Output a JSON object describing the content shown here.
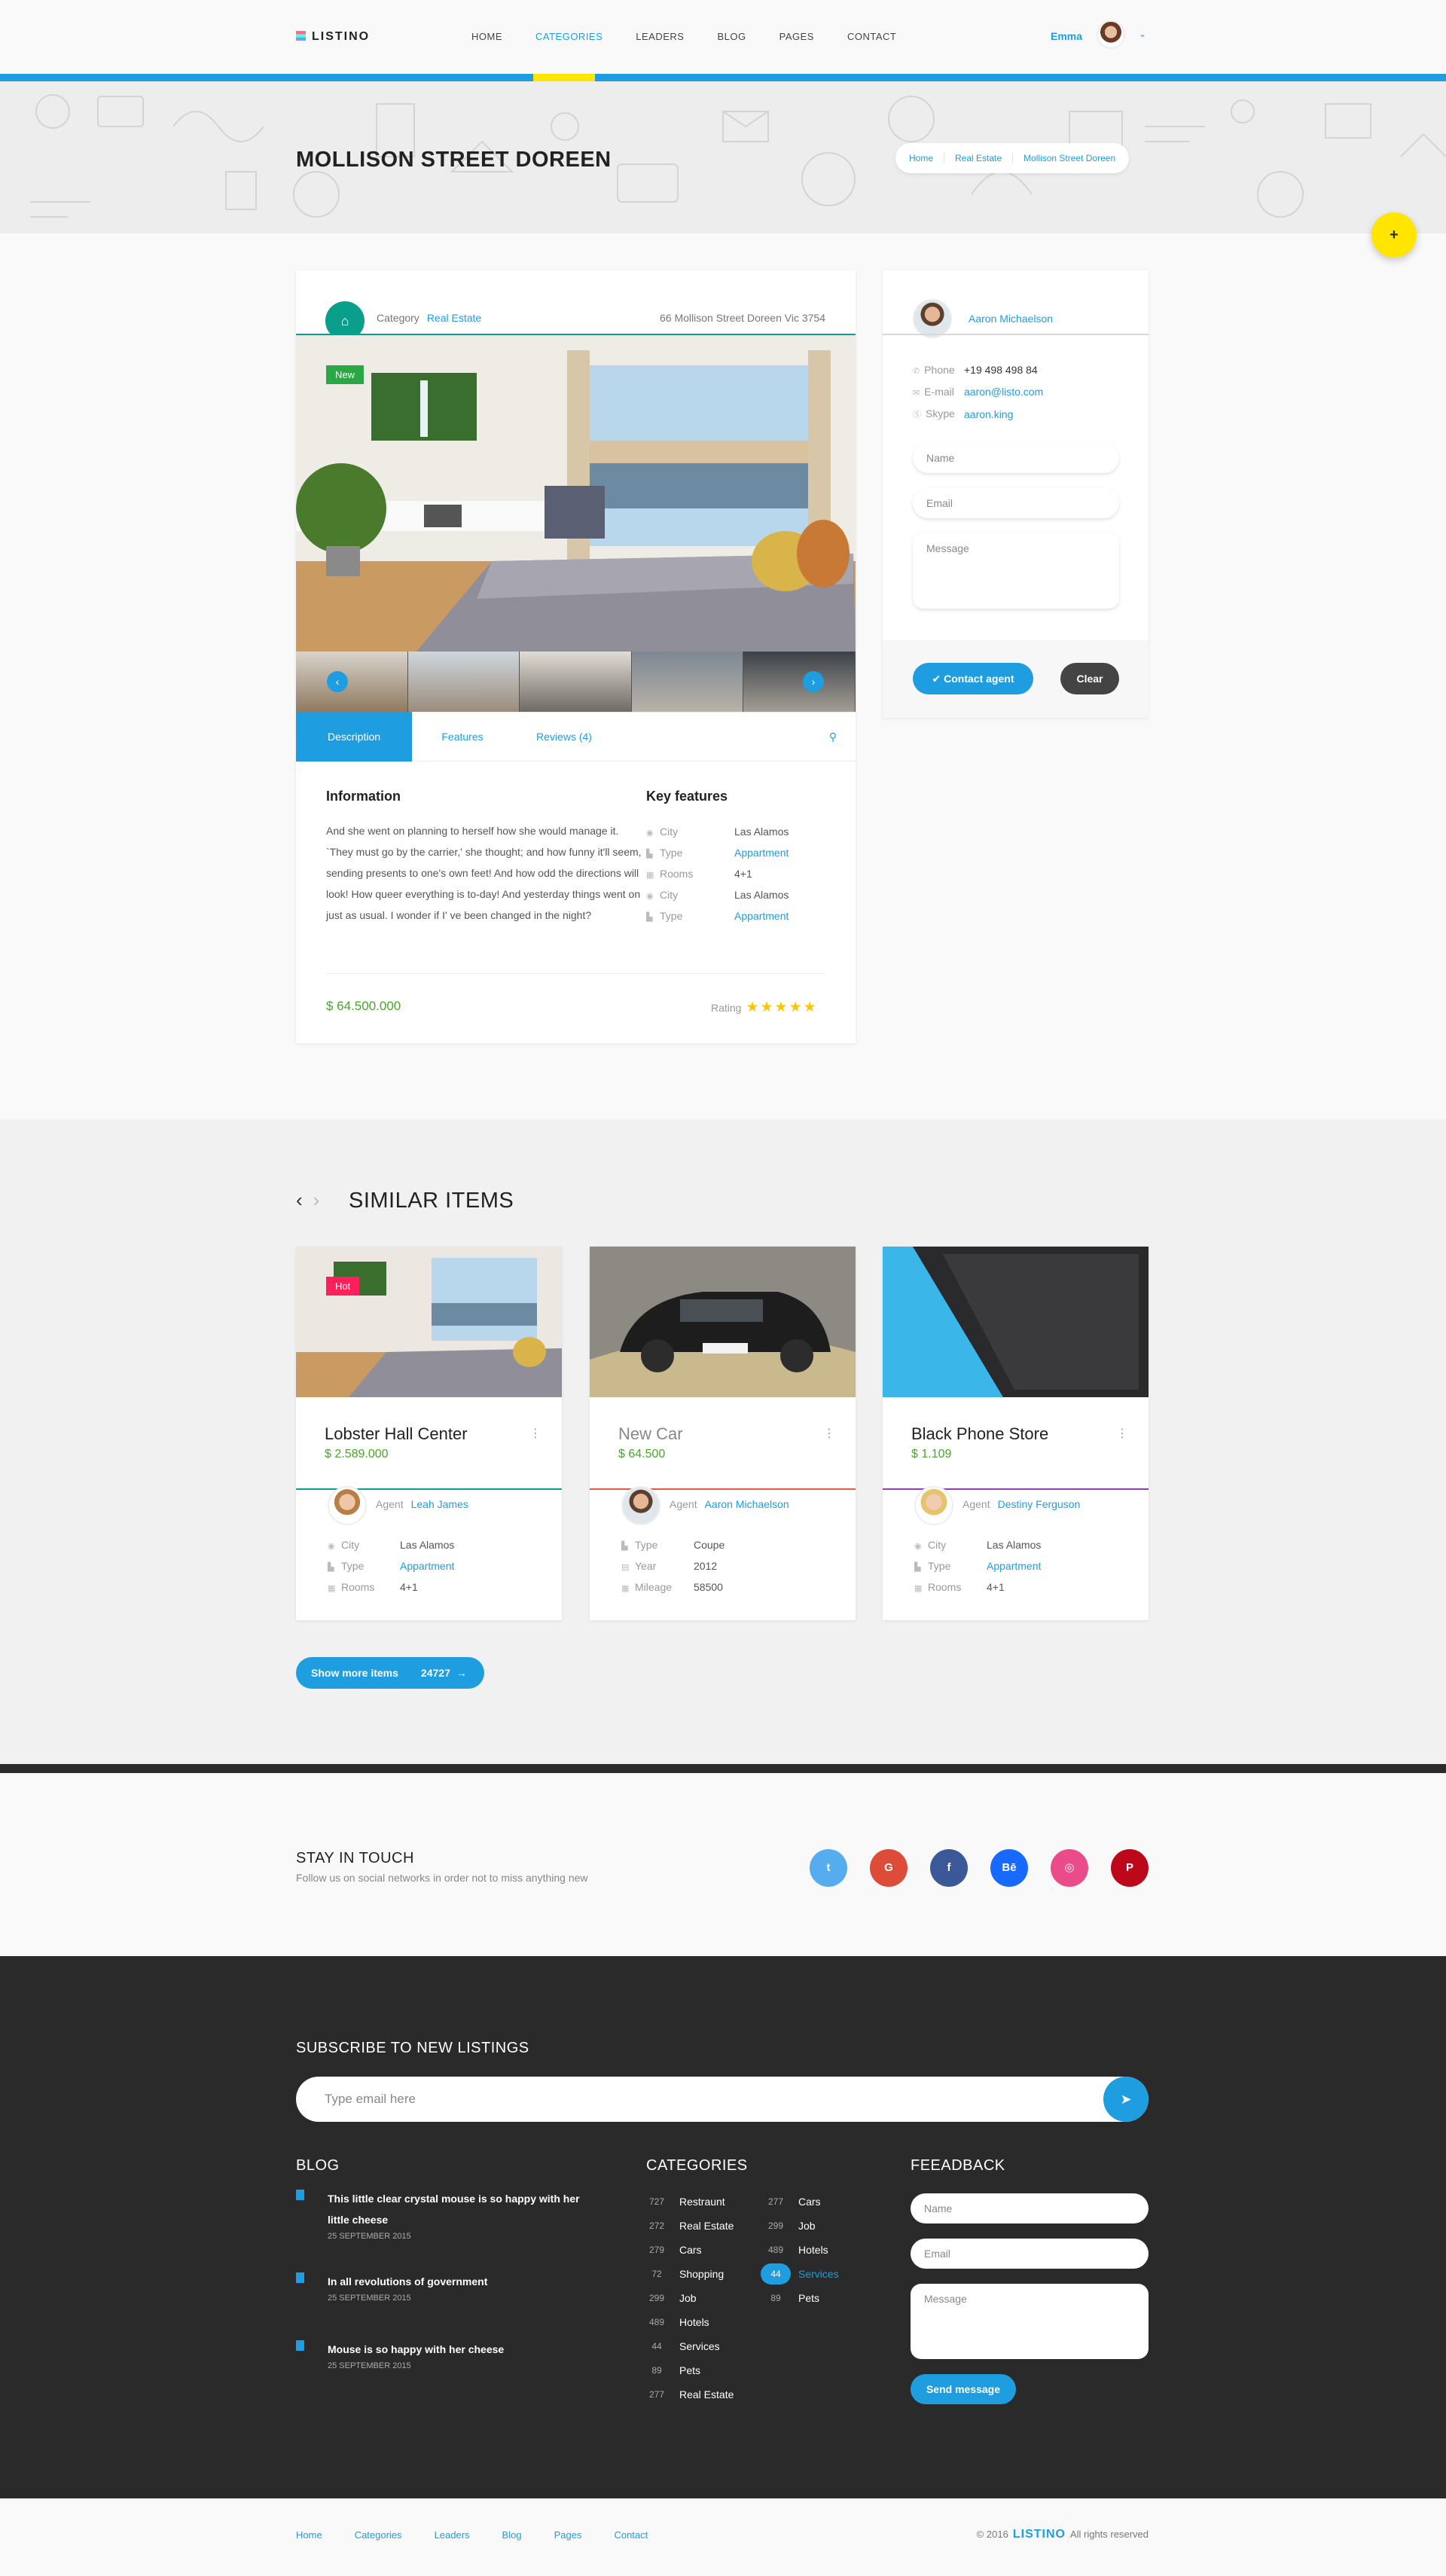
{
  "header": {
    "logo": "LISTINO",
    "nav": [
      "HOME",
      "CATEGORIES",
      "LEADERS",
      "BLOG",
      "PAGES",
      "CONTACT"
    ],
    "active_nav": "CATEGORIES",
    "user": "Emma"
  },
  "hero": {
    "title": "MOLLISON STREET DOREEN",
    "breadcrumbs": [
      "Home",
      "Real Estate",
      "Mollison Street Doreen"
    ],
    "fab": "+"
  },
  "listing": {
    "category_label": "Category",
    "category": "Real Estate",
    "address": "66 Mollison Street Doreen Vic 3754",
    "badge": "New",
    "tabs": [
      "Description",
      "Features",
      "Reviews (4)"
    ],
    "info_title": "Information",
    "info_text": "And she went on planning to herself how she would manage it. `They must go by the carrier,' she thought; and how funny it'll seem, sending presents to one's own feet! And how odd the directions will look!  How queer everything is to-day! And yesterday things went on just as usual. I wonder if I' ve been changed in the night?",
    "features_title": "Key features",
    "features": [
      {
        "icon": "location-icon",
        "k": "City",
        "v": "Las Alamos",
        "link": false
      },
      {
        "icon": "building-icon",
        "k": "Type",
        "v": "Appartment",
        "link": true
      },
      {
        "icon": "grid-icon",
        "k": "Rooms",
        "v": "4+1",
        "link": false
      },
      {
        "icon": "location-icon",
        "k": "City",
        "v": "Las Alamos",
        "link": false
      },
      {
        "icon": "building-icon",
        "k": "Type",
        "v": "Appartment",
        "link": true
      }
    ],
    "price": "$ 64.500.000",
    "rating_label": "Rating",
    "stars": "★★★★★"
  },
  "agent": {
    "name": "Aaron Michaelson",
    "phone_label": "Phone",
    "phone": "+19 498 498 84",
    "email_label": "E-mail",
    "email": "aaron@listo.com",
    "skype_label": "Skype",
    "skype": "aaron.king",
    "name_ph": "Name",
    "email_ph": "Email",
    "message_ph": "Message",
    "contact_btn": "Contact agent",
    "clear_btn": "Clear"
  },
  "similar": {
    "title": "SIMILAR ITEMS",
    "items": [
      {
        "name": "Lobster Hall Center",
        "price": "$ 2.589.000",
        "badge": "Hot",
        "agent_label": "Agent",
        "agent": "Leah James",
        "color": "#0a9f8a",
        "rows": [
          [
            "City",
            "Las Alamos",
            false
          ],
          [
            "Type",
            "Appartment",
            true
          ],
          [
            "Rooms",
            "4+1",
            false
          ]
        ]
      },
      {
        "name": "New Car",
        "price": "$ 64.500",
        "badge": "",
        "agent_label": "Agent",
        "agent": "Aaron Michaelson",
        "color": "#e55a3c",
        "rows": [
          [
            "Type",
            "Coupe",
            false
          ],
          [
            "Year",
            "2012",
            false
          ],
          [
            "Mileage",
            "58500",
            false
          ]
        ]
      },
      {
        "name": "Black Phone Store",
        "price": "$ 1.109",
        "badge": "",
        "agent_label": "Agent",
        "agent": "Destiny Ferguson",
        "color": "#8e3fb3",
        "rows": [
          [
            "City",
            "Las Alamos",
            false
          ],
          [
            "Type",
            "Appartment",
            true
          ],
          [
            "Rooms",
            "4+1",
            false
          ]
        ]
      }
    ],
    "more_label": "Show more items",
    "more_count": "24727"
  },
  "touch": {
    "title": "STAY IN TOUCH",
    "subtitle": "Follow us on social networks in order not to miss anything new",
    "socials": [
      {
        "name": "twitter-icon",
        "glyph": "t",
        "color": "#55acee"
      },
      {
        "name": "google-icon",
        "glyph": "G",
        "color": "#dd4b39"
      },
      {
        "name": "facebook-icon",
        "glyph": "f",
        "color": "#3b5998"
      },
      {
        "name": "behance-icon",
        "glyph": "Bē",
        "color": "#1769ff"
      },
      {
        "name": "dribbble-icon",
        "glyph": "◎",
        "color": "#ea4c89"
      },
      {
        "name": "pinterest-icon",
        "glyph": "P",
        "color": "#bd081c"
      }
    ]
  },
  "footer": {
    "subscribe_title": "SUBSCRIBE TO NEW LISTINGS",
    "subscribe_ph": "Type email here",
    "blog_title": "BLOG",
    "blog": [
      {
        "title": "This little clear crystal mouse is so happy with her little cheese",
        "date": "25 SEPTEMBER 2015"
      },
      {
        "title": "In all revolutions of government",
        "date": "25 SEPTEMBER 2015"
      },
      {
        "title": "Mouse is so happy with her cheese",
        "date": "25 SEPTEMBER 2015"
      }
    ],
    "categories_title": "CATEGORIES",
    "categories_left": [
      [
        "727",
        "Restraunt"
      ],
      [
        "272",
        "Real Estate"
      ],
      [
        "279",
        "Cars"
      ],
      [
        "72",
        "Shopping"
      ],
      [
        "299",
        "Job"
      ],
      [
        "489",
        "Hotels"
      ],
      [
        "44",
        "Services"
      ],
      [
        "89",
        "Pets"
      ],
      [
        "277",
        "Real Estate"
      ]
    ],
    "categories_right": [
      [
        "277",
        "Cars"
      ],
      [
        "299",
        "Job"
      ],
      [
        "489",
        "Hotels"
      ],
      [
        "44",
        "Services"
      ],
      [
        "89",
        "Pets"
      ]
    ],
    "selected_right": "Services",
    "feedback_title": "FEEADBACK",
    "fb_name_ph": "Name",
    "fb_email_ph": "Email",
    "fb_message_ph": "Message",
    "send_btn": "Send message"
  },
  "bottom": {
    "nav": [
      "Home",
      "Categories",
      "Leaders",
      "Blog",
      "Pages",
      "Contact"
    ],
    "copy_year": "© 2016",
    "copy_brand": "LISTINO",
    "copy_rights": "All rights reserved"
  }
}
